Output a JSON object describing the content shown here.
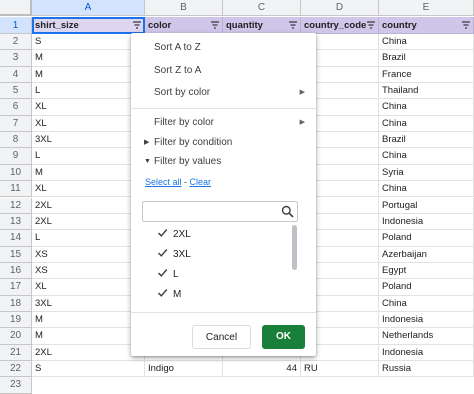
{
  "columns": [
    "A",
    "B",
    "C",
    "D",
    "E"
  ],
  "headers": [
    "shirt_size",
    "color",
    "quantity",
    "country_code",
    "country"
  ],
  "row_numbers": [
    "1",
    "2",
    "3",
    "4",
    "5",
    "6",
    "7",
    "8",
    "9",
    "10",
    "11",
    "12",
    "13",
    "14",
    "15",
    "16",
    "17",
    "18",
    "19",
    "20",
    "21",
    "22",
    "23"
  ],
  "rows": [
    {
      "shirt_size": "S",
      "color": "",
      "quantity": "",
      "country_code": "",
      "country": "China"
    },
    {
      "shirt_size": "M",
      "color": "",
      "quantity": "",
      "country_code": "",
      "country": "Brazil"
    },
    {
      "shirt_size": "M",
      "color": "",
      "quantity": "",
      "country_code": "",
      "country": "France"
    },
    {
      "shirt_size": "L",
      "color": "",
      "quantity": "",
      "country_code": "",
      "country": "Thailand"
    },
    {
      "shirt_size": "XL",
      "color": "",
      "quantity": "",
      "country_code": "",
      "country": "China"
    },
    {
      "shirt_size": "XL",
      "color": "",
      "quantity": "",
      "country_code": "",
      "country": "China"
    },
    {
      "shirt_size": "3XL",
      "color": "",
      "quantity": "",
      "country_code": "",
      "country": "Brazil"
    },
    {
      "shirt_size": "L",
      "color": "",
      "quantity": "",
      "country_code": "",
      "country": "China"
    },
    {
      "shirt_size": "M",
      "color": "",
      "quantity": "",
      "country_code": "",
      "country": "Syria"
    },
    {
      "shirt_size": "XL",
      "color": "",
      "quantity": "",
      "country_code": "",
      "country": "China"
    },
    {
      "shirt_size": "2XL",
      "color": "",
      "quantity": "",
      "country_code": "",
      "country": "Portugal"
    },
    {
      "shirt_size": "2XL",
      "color": "",
      "quantity": "",
      "country_code": "",
      "country": "Indonesia"
    },
    {
      "shirt_size": "L",
      "color": "",
      "quantity": "",
      "country_code": "",
      "country": "Poland"
    },
    {
      "shirt_size": "XS",
      "color": "",
      "quantity": "",
      "country_code": "",
      "country": "Azerbaijan"
    },
    {
      "shirt_size": "XS",
      "color": "",
      "quantity": "",
      "country_code": "",
      "country": "Egypt"
    },
    {
      "shirt_size": "XL",
      "color": "",
      "quantity": "",
      "country_code": "",
      "country": "Poland"
    },
    {
      "shirt_size": "3XL",
      "color": "",
      "quantity": "",
      "country_code": "",
      "country": "China"
    },
    {
      "shirt_size": "M",
      "color": "",
      "quantity": "",
      "country_code": "",
      "country": "Indonesia"
    },
    {
      "shirt_size": "M",
      "color": "",
      "quantity": "",
      "country_code": "",
      "country": "Netherlands"
    },
    {
      "shirt_size": "2XL",
      "color": "",
      "quantity": "",
      "country_code": "",
      "country": "Indonesia"
    },
    {
      "shirt_size": "S",
      "color": "Indigo",
      "quantity": "44",
      "country_code": "RU",
      "country": "Russia"
    }
  ],
  "menu": {
    "sort_az": "Sort A to Z",
    "sort_za": "Sort Z to A",
    "sort_color": "Sort by color",
    "filter_color": "Filter by color",
    "filter_condition": "Filter by condition",
    "filter_values": "Filter by values",
    "select_all": "Select all",
    "separator": " - ",
    "clear": "Clear",
    "search_placeholder": "",
    "values": [
      {
        "label": "2XL",
        "checked": true
      },
      {
        "label": "3XL",
        "checked": true
      },
      {
        "label": "L",
        "checked": true
      },
      {
        "label": "M",
        "checked": true
      }
    ],
    "cancel": "Cancel",
    "ok": "OK"
  },
  "colors": {
    "header_fill": "#cfc6ea",
    "ok_green": "#188038",
    "link_blue": "#1a73e8",
    "selection": "#d3e3fd"
  }
}
